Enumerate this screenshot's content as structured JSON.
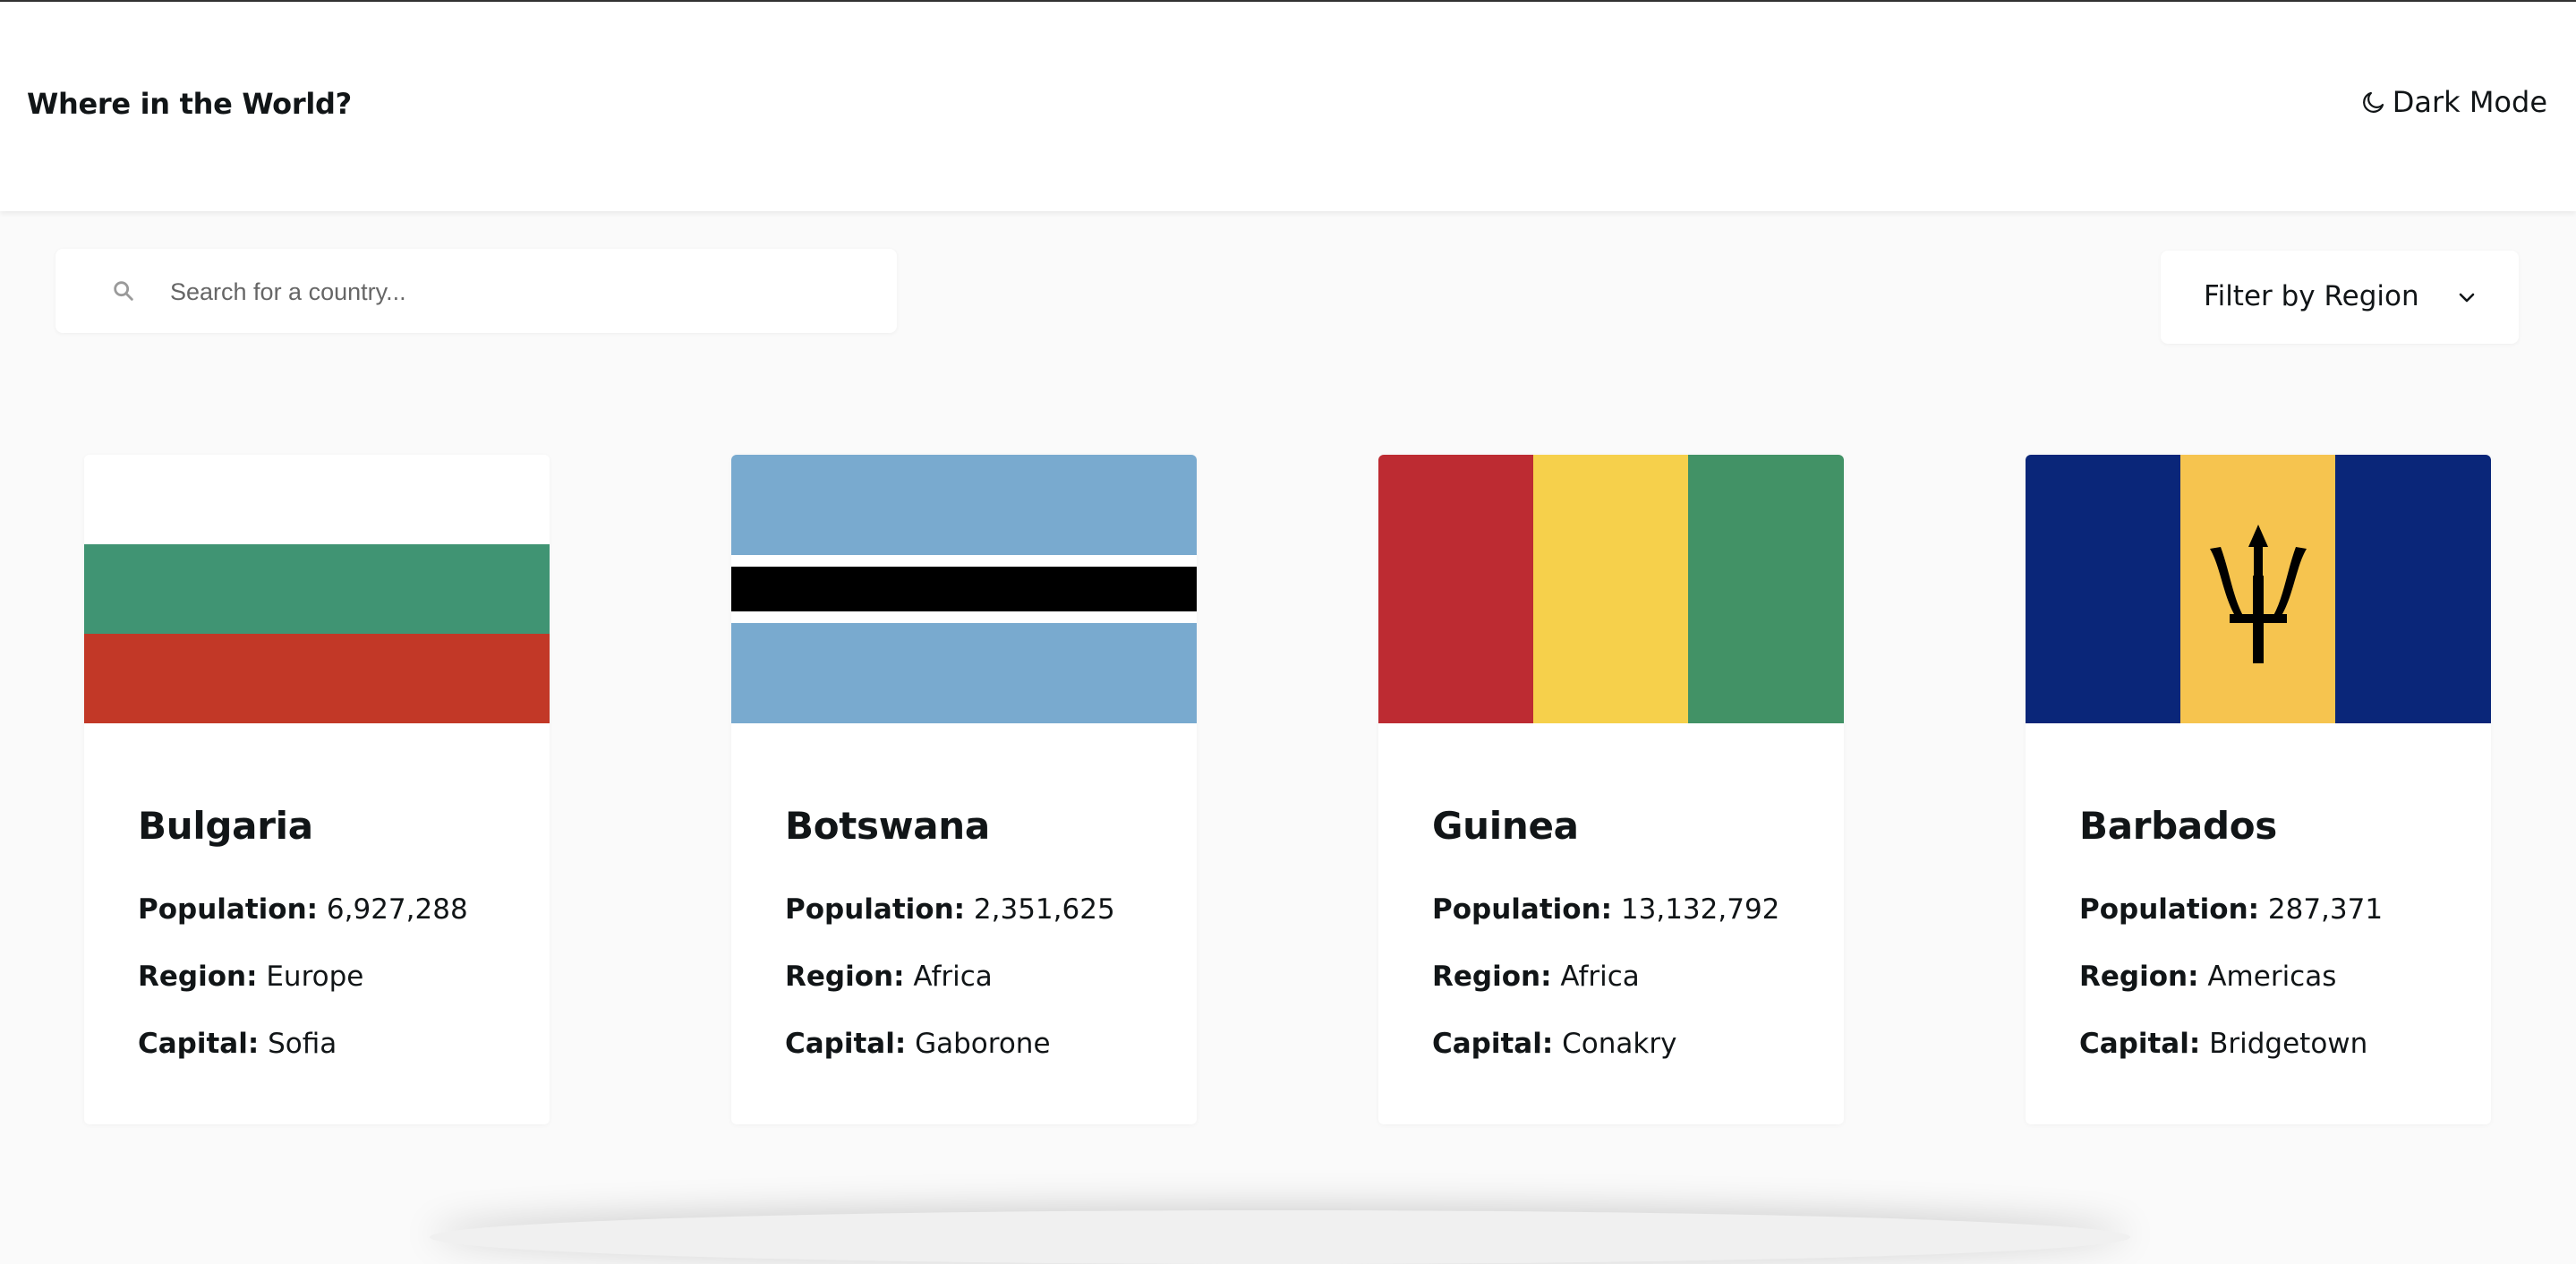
{
  "header": {
    "title": "Where in the World?",
    "mode_label": "Dark Mode",
    "mode_icon": "moon-icon"
  },
  "search": {
    "placeholder": "Search for a country...",
    "value": ""
  },
  "filter": {
    "label": "Filter by Region"
  },
  "labels": {
    "population": "Population:",
    "region": "Region:",
    "capital": "Capital:"
  },
  "countries": [
    {
      "name": "Bulgaria",
      "population": "6,927,288",
      "region": "Europe",
      "capital": "Sofia",
      "flag": {
        "type": "horizontal-tricolor",
        "colors": [
          "#ffffff",
          "#409473",
          "#c23827"
        ]
      }
    },
    {
      "name": "Botswana",
      "population": "2,351,625",
      "region": "Africa",
      "capital": "Gaborone",
      "flag": {
        "type": "botswana",
        "colors": [
          "#79aacf",
          "#ffffff",
          "#000000"
        ]
      }
    },
    {
      "name": "Guinea",
      "population": "13,132,792",
      "region": "Africa",
      "capital": "Conakry",
      "flag": {
        "type": "vertical-tricolor",
        "colors": [
          "#bd2b32",
          "#f6d04b",
          "#429266"
        ]
      }
    },
    {
      "name": "Barbados",
      "population": "287,371",
      "region": "Americas",
      "capital": "Bridgetown",
      "flag": {
        "type": "barbados",
        "colors": [
          "#0a2679",
          "#f6c44f",
          "#000000"
        ]
      }
    }
  ]
}
